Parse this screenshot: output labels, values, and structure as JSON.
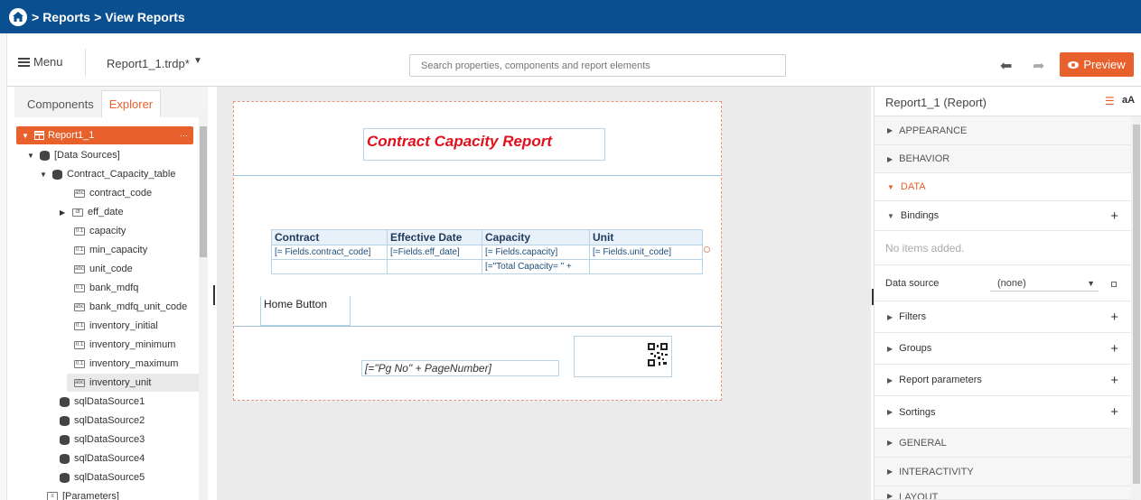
{
  "topbar": {
    "home_icon": "home-icon",
    "crumb_sep1": ">",
    "crumb_reports": "Reports",
    "crumb_sep2": ">",
    "crumb_view": "View Reports"
  },
  "toolbar": {
    "menu_label": "Menu",
    "file_name": "Report1_1.trdp*",
    "search_placeholder": "Search properties, components and report elements",
    "preview_label": "Preview"
  },
  "left_panel": {
    "tabs": [
      "Components",
      "Explorer"
    ],
    "root": "Report1_1",
    "root_dots": "···",
    "data_sources": "[Data Sources]",
    "table": "Contract_Capacity_table",
    "fields": [
      {
        "name": "contract_code",
        "type": "abc"
      },
      {
        "name": "eff_date",
        "type": "dt"
      },
      {
        "name": "capacity",
        "type": "0.1"
      },
      {
        "name": "min_capacity",
        "type": "0.1"
      },
      {
        "name": "unit_code",
        "type": "abc"
      },
      {
        "name": "bank_mdfq",
        "type": "0.1"
      },
      {
        "name": "bank_mdfq_unit_code",
        "type": "abc"
      },
      {
        "name": "inventory_initial",
        "type": "0.1"
      },
      {
        "name": "inventory_minimum",
        "type": "0.1"
      },
      {
        "name": "inventory_maximum",
        "type": "0.1"
      },
      {
        "name": "inventory_unit",
        "type": "abc"
      }
    ],
    "sources": [
      "sqlDataSource1",
      "sqlDataSource2",
      "sqlDataSource3",
      "sqlDataSource4",
      "sqlDataSource5"
    ],
    "parameters": "[Parameters]"
  },
  "report": {
    "title": "Contract Capacity Report",
    "table": {
      "headers": [
        "Contract",
        "Effective Date",
        "Capacity",
        "Unit"
      ],
      "row1": [
        "[= Fields.contract_code]",
        "[=Fields.eff_date]",
        "[= Fields.capacity]",
        "[= Fields.unit_code]"
      ],
      "row2": [
        "",
        "",
        "[=\"Total Capacity= \" +",
        ""
      ]
    },
    "home_button": "Home Button",
    "page_number": "[=\"Pg No\" + PageNumber]"
  },
  "properties": {
    "title": "Report1_1 (Report)",
    "sections": {
      "appearance": "APPEARANCE",
      "behavior": "BEHAVIOR",
      "data": "DATA",
      "general": "GENERAL",
      "interactivity": "INTERACTIVITY",
      "layout": "LAYOUT"
    },
    "bindings": "Bindings",
    "no_items": "No items added.",
    "data_source_label": "Data source",
    "data_source_value": "(none)",
    "filters": "Filters",
    "groups": "Groups",
    "report_parameters": "Report parameters",
    "sortings": "Sortings",
    "plus": "+",
    "aa": "aA"
  },
  "colors": {
    "topbar": "#0a4f8f",
    "accent": "#e8612c",
    "title_red": "#e0101d"
  }
}
